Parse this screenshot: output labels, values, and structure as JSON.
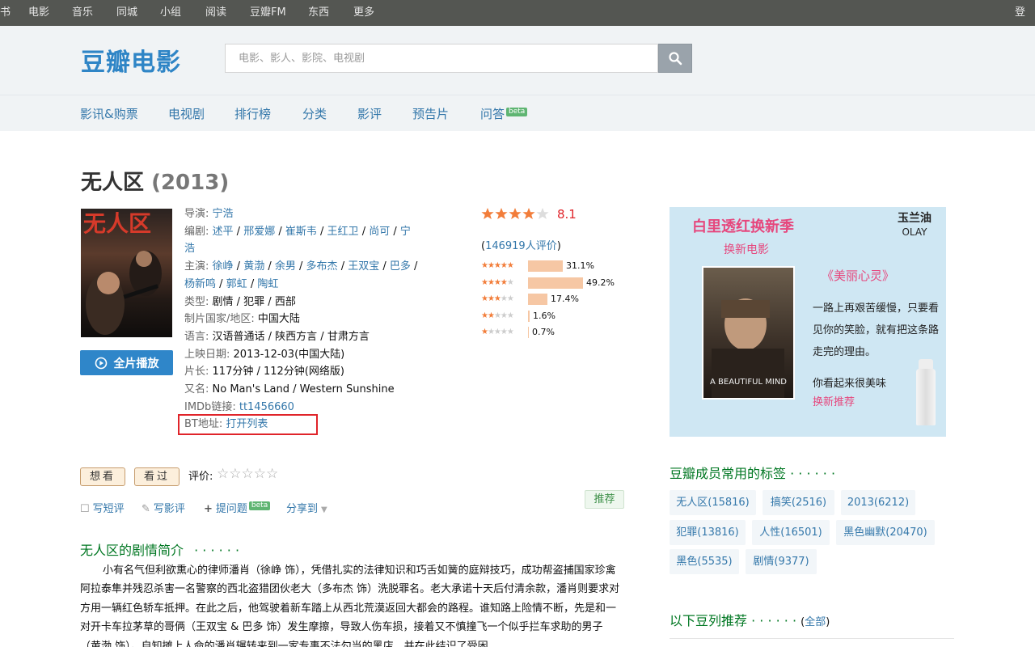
{
  "topbar": {
    "items": [
      "书",
      "电影",
      "音乐",
      "同城",
      "小组",
      "阅读",
      "豆瓣FM",
      "东西",
      "更多"
    ],
    "login": "登录"
  },
  "header": {
    "logo": "豆瓣电影",
    "search_placeholder": "电影、影人、影院、电视剧",
    "search_icon": "search-icon"
  },
  "nav": {
    "items": [
      "影讯&购票",
      "电视剧",
      "排行榜",
      "分类",
      "影评",
      "预告片",
      "问答"
    ],
    "beta": "beta"
  },
  "movie": {
    "title": "无人区",
    "year": "(2013)",
    "poster_text": "无人区",
    "play_label": "全片播放"
  },
  "info": {
    "director_label": "导演:",
    "director": "宁浩",
    "writer_label": "编剧:",
    "writers": [
      "述平",
      "邢爱娜",
      "崔斯韦",
      "王红卫",
      "尚可",
      "宁浩"
    ],
    "cast_label": "主演:",
    "cast": [
      "徐峥",
      "黄渤",
      "余男",
      "多布杰",
      "王双宝",
      "巴多",
      "杨新鸣",
      "郭虹",
      "陶虹"
    ],
    "genre_label": "类型:",
    "genre": "剧情 / 犯罪 / 西部",
    "country_label": "制片国家/地区:",
    "country": "中国大陆",
    "language_label": "语言:",
    "language": "汉语普通话 / 陕西方言 / 甘肃方言",
    "release_label": "上映日期:",
    "release": "2013-12-03(中国大陆)",
    "runtime_label": "片长:",
    "runtime": "117分钟 / 112分钟(网络版)",
    "aka_label": "又名:",
    "aka": "No Man's Land / Western Sunshine",
    "imdb_label": "IMDb链接:",
    "imdb": "tt1456660",
    "bt_label": "BT地址:",
    "bt_link": "打开列表"
  },
  "rating": {
    "score": "8.1",
    "stars_value": 4,
    "count_open": "(",
    "count_link": "146919人评价",
    "count_close": ")",
    "rows": [
      {
        "stars": 5,
        "pct": "31.1%",
        "value": 31.1
      },
      {
        "stars": 4,
        "pct": "49.2%",
        "value": 49.2
      },
      {
        "stars": 3,
        "pct": "17.4%",
        "value": 17.4
      },
      {
        "stars": 2,
        "pct": "1.6%",
        "value": 1.6
      },
      {
        "stars": 1,
        "pct": "0.7%",
        "value": 0.7
      }
    ]
  },
  "actions": {
    "want": "想看",
    "seen": "看过",
    "rate_label": "评价:",
    "write_short": "写短评",
    "write_review": "写影评",
    "ask": "提问题",
    "beta": "beta",
    "share": "分享到",
    "recommend": "推荐"
  },
  "synopsis": {
    "title": "无人区的剧情简介",
    "dots": "· · · · · ·",
    "body": "小有名气但利欲熏心的律师潘肖（徐峥 饰），凭借扎实的法律知识和巧舌如簧的庭辩技巧，成功帮盗捕国家珍禽阿拉泰隼并残忍杀害一名警察的西北盗猎团伙老大（多布杰 饰）洗脱罪名。老大承诺十天后付清余款，潘肖则要求对方用一辆红色轿车抵押。在此之后，他驾驶着新车踏上从西北荒漠返回大都会的路程。谁知路上险情不断，先是和一对开卡车拉茅草的哥俩（王双宝 & 巴多 饰）发生摩擦，导致人伤车损，接着又不慎撞飞一个似乎拦车求助的男子（黄渤 饰）。自知摊上人命的潘肖辗转来到一家专事不法勾当的黑店，并在此结识了受困"
  },
  "ad": {
    "headline": "白里透红换新季",
    "subline": "换新电影",
    "brand_cn": "玉兰油",
    "brand_en": "OLAY",
    "film_title": "《美丽心灵》",
    "poster_text": "A BEAUTIFUL MIND",
    "copy": "一路上再艰苦缓慢，只要看见你的笑脸，就有把这条路走完的理由。",
    "tagline": "你看起来很美味",
    "tagline2": "换新推荐"
  },
  "tags": {
    "title": "豆瓣成员常用的标签",
    "dots": "· · · · · ·",
    "items": [
      "无人区(15816)",
      "搞笑(2516)",
      "2013(6212)",
      "犯罪(13816)",
      "人性(16501)",
      "黑色幽默(20470)",
      "黑色(5535)",
      "剧情(9377)"
    ]
  },
  "doulist": {
    "title": "以下豆列推荐",
    "dots": "· · · · · ·",
    "open": "(",
    "all": "全部",
    "close": ")"
  },
  "colors": {
    "link": "#3377aa",
    "green": "#007722",
    "star": "#f27d3a",
    "score": "#e0242a",
    "highlight_box": "#e0242a"
  }
}
